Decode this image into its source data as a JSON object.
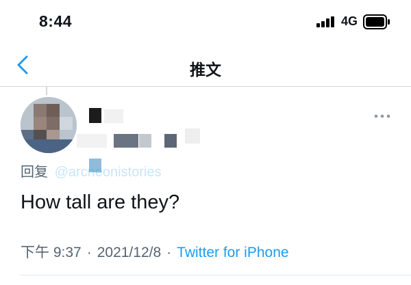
{
  "status_bar": {
    "time": "8:44",
    "network": "4G",
    "signal_icon": "signal-bars-icon",
    "battery_icon": "battery-icon"
  },
  "nav": {
    "back_icon": "chevron-left-icon",
    "title": "推文"
  },
  "tweet": {
    "display_name": "",
    "handle": "",
    "reply_prefix": "回复",
    "reply_handle": "@arcneonistories",
    "text": "How tall are they?",
    "time": "下午 9:37",
    "date": "2021/12/8",
    "separator": "·",
    "source": "Twitter for iPhone",
    "more_icon": "more-horizontal-icon"
  },
  "colors": {
    "accent": "#1d9bf0",
    "text": "#0f1419",
    "secondary": "#536471",
    "divider": "#d6d6d6"
  }
}
